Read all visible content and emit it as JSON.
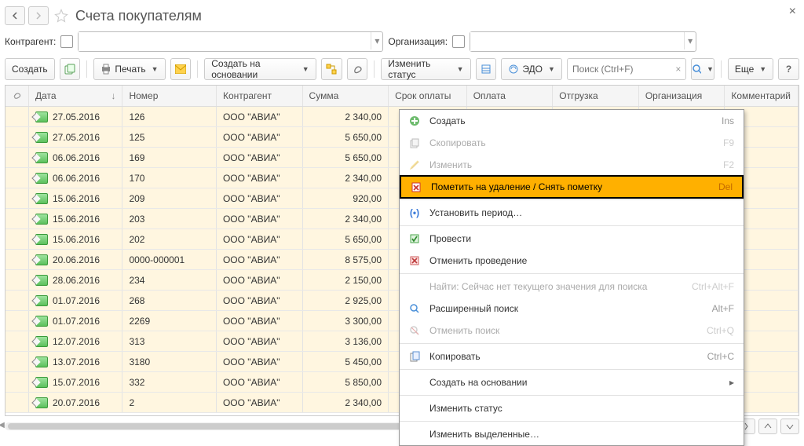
{
  "title": "Счета покупателям",
  "filters": {
    "contractor_label": "Контрагент:",
    "organization_label": "Организация:"
  },
  "toolbar": {
    "create": "Создать",
    "print": "Печать",
    "create_based": "Создать на основании",
    "change_status": "Изменить статус",
    "edo": "ЭДО",
    "search_placeholder": "Поиск (Ctrl+F)",
    "more": "Еще"
  },
  "columns": {
    "date": "Дата",
    "number": "Номер",
    "contractor": "Контрагент",
    "sum": "Сумма",
    "pay_due": "Срок оплаты",
    "payment": "Оплата",
    "shipment": "Отгрузка",
    "org": "Организация",
    "comment": "Комментарий"
  },
  "rows": [
    {
      "date": "27.05.2016",
      "num": "126",
      "kont": "ООО \"АВИА\"",
      "sum": "2 340,00"
    },
    {
      "date": "27.05.2016",
      "num": "125",
      "kont": "ООО \"АВИА\"",
      "sum": "5 650,00"
    },
    {
      "date": "06.06.2016",
      "num": "169",
      "kont": "ООО \"АВИА\"",
      "sum": "5 650,00"
    },
    {
      "date": "06.06.2016",
      "num": "170",
      "kont": "ООО \"АВИА\"",
      "sum": "2 340,00"
    },
    {
      "date": "15.06.2016",
      "num": "209",
      "kont": "ООО \"АВИА\"",
      "sum": "920,00"
    },
    {
      "date": "15.06.2016",
      "num": "203",
      "kont": "ООО \"АВИА\"",
      "sum": "2 340,00"
    },
    {
      "date": "15.06.2016",
      "num": "202",
      "kont": "ООО \"АВИА\"",
      "sum": "5 650,00"
    },
    {
      "date": "20.06.2016",
      "num": "0000-000001",
      "kont": "ООО \"АВИА\"",
      "sum": "8 575,00"
    },
    {
      "date": "28.06.2016",
      "num": "234",
      "kont": "ООО \"АВИА\"",
      "sum": "2 150,00"
    },
    {
      "date": "01.07.2016",
      "num": "268",
      "kont": "ООО \"АВИА\"",
      "sum": "2 925,00"
    },
    {
      "date": "01.07.2016",
      "num": "2269",
      "kont": "ООО \"АВИА\"",
      "sum": "3 300,00"
    },
    {
      "date": "12.07.2016",
      "num": "313",
      "kont": "ООО \"АВИА\"",
      "sum": "3 136,00"
    },
    {
      "date": "13.07.2016",
      "num": "3180",
      "kont": "ООО \"АВИА\"",
      "sum": "5 450,00"
    },
    {
      "date": "15.07.2016",
      "num": "332",
      "kont": "ООО \"АВИА\"",
      "sum": "5 850,00"
    },
    {
      "date": "20.07.2016",
      "num": "2",
      "kont": "ООО \"АВИА\"",
      "sum": "2 340,00"
    }
  ],
  "ctx": {
    "create": {
      "l": "Создать",
      "s": "Ins"
    },
    "copy": {
      "l": "Скопировать",
      "s": "F9"
    },
    "edit": {
      "l": "Изменить",
      "s": "F2"
    },
    "mark_delete": {
      "l": "Пометить на удаление / Снять пометку",
      "s": "Del"
    },
    "set_period": {
      "l": "Установить период…",
      "s": ""
    },
    "post": {
      "l": "Провести",
      "s": ""
    },
    "unpost": {
      "l": "Отменить проведение",
      "s": ""
    },
    "find": {
      "l": "Найти: Сейчас нет текущего значения для поиска",
      "s": "Ctrl+Alt+F"
    },
    "adv_find": {
      "l": "Расширенный поиск",
      "s": "Alt+F"
    },
    "cancel_find": {
      "l": "Отменить поиск",
      "s": "Ctrl+Q"
    },
    "copy2": {
      "l": "Копировать",
      "s": "Ctrl+C"
    },
    "create_based": {
      "l": "Создать на основании",
      "s": ""
    },
    "change_status": {
      "l": "Изменить статус",
      "s": ""
    },
    "change_sel": {
      "l": "Изменить выделенные…",
      "s": ""
    }
  }
}
